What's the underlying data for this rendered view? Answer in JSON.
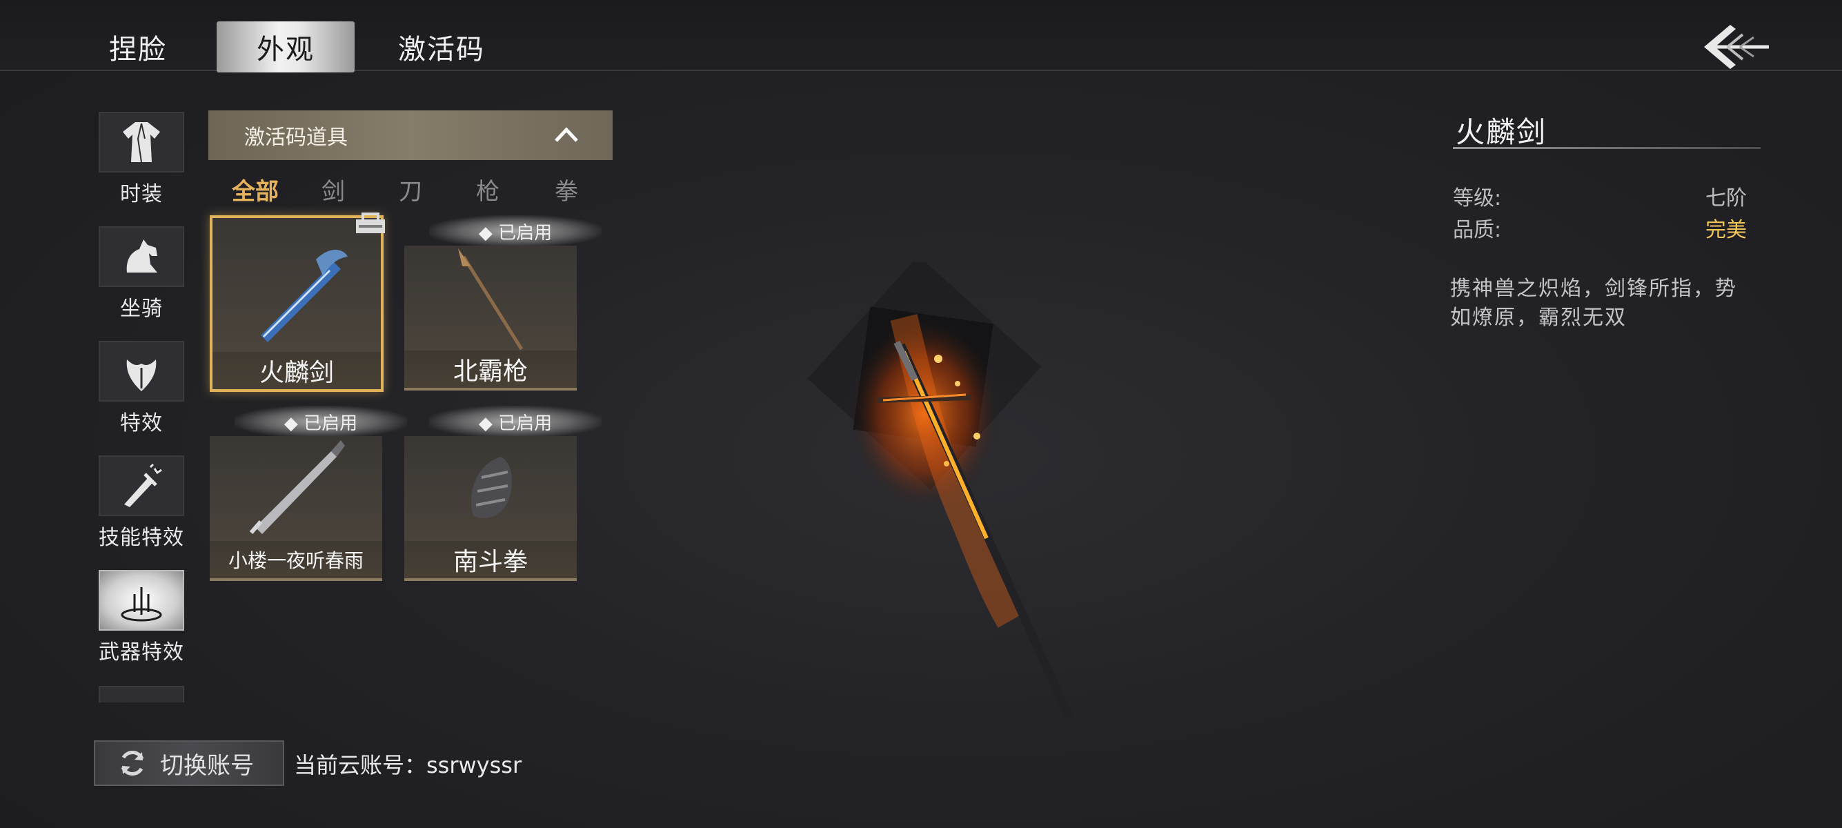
{
  "top_tabs": [
    {
      "label": "捏脸"
    },
    {
      "label": "外观"
    },
    {
      "label": "激活码"
    }
  ],
  "categories": [
    {
      "label": "时装",
      "icon": "robe-icon"
    },
    {
      "label": "坐骑",
      "icon": "horse-icon"
    },
    {
      "label": "特效",
      "icon": "effect-icon"
    },
    {
      "label": "技能特效",
      "icon": "skill-effect-icon"
    },
    {
      "label": "武器特效",
      "icon": "weapon-effect-icon"
    }
  ],
  "dropdown": {
    "label": "激活码道具",
    "icon": "chevron-up-icon"
  },
  "filters": [
    {
      "label": "全部"
    },
    {
      "label": "剑"
    },
    {
      "label": "刀"
    },
    {
      "label": "枪"
    },
    {
      "label": "拳"
    }
  ],
  "items": [
    {
      "name": "火麟剑",
      "badge": "",
      "selected": true,
      "icon": "flame-sword-icon"
    },
    {
      "name": "北霸枪",
      "badge": "◆ 已启用",
      "selected": false,
      "icon": "spear-icon"
    },
    {
      "name": "小楼一夜听春雨",
      "badge": "◆ 已启用",
      "selected": false,
      "icon": "blade-icon"
    },
    {
      "name": "南斗拳",
      "badge": "◆ 已启用",
      "selected": false,
      "icon": "gauntlet-icon"
    }
  ],
  "detail": {
    "title": "火麟剑",
    "grade_label": "等级:",
    "grade_value": "七阶",
    "quality_label": "品质:",
    "quality_value": "完美",
    "description": "携神兽之炽焰，剑锋所指，势如燎原，霸烈无双"
  },
  "footer": {
    "switch_label": "切换账号",
    "account_label": "当前云账号：ssrwyssr"
  },
  "colors": {
    "accent_gold": "#e6b25c",
    "quality_gold": "#f3c65a",
    "selected_border": "#e0b25a"
  }
}
